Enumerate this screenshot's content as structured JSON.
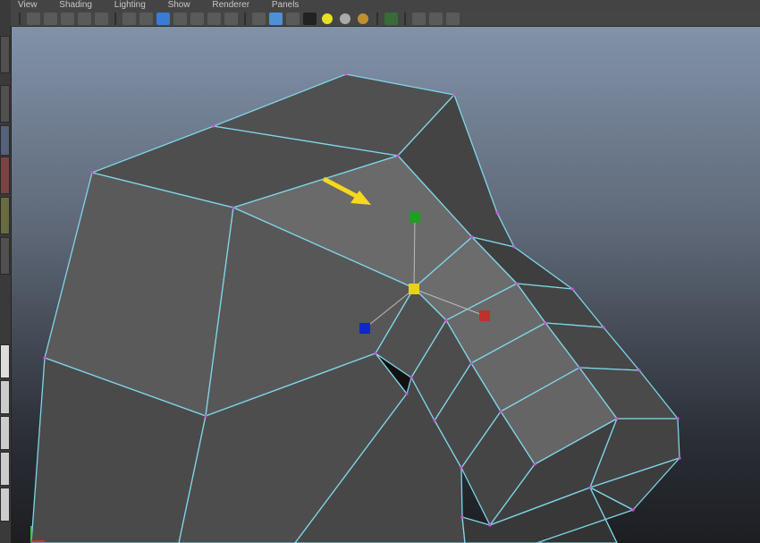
{
  "menu": [
    "View",
    "Shading",
    "Lighting",
    "Show",
    "Renderer",
    "Panels"
  ],
  "toolbar": {
    "groups": [
      [
        "camera-attributes-icon",
        "camera-bookmarks-icon",
        "image-plane-icon",
        "2d-pan-zoom-icon",
        "grease-pencil-icon"
      ],
      [
        "grid-icon",
        "film-gate-icon",
        "resolution-gate-icon",
        "gate-mask-icon",
        "field-chart-icon",
        "safe-action-icon",
        "safe-title-icon"
      ],
      [
        "wireframe-icon",
        "smooth-shade-icon",
        "wireframe-on-shaded-icon",
        "textured-icon",
        "default-lighting-icon",
        "all-lights-icon",
        "shadows-icon"
      ],
      [
        "isolate-select-icon"
      ],
      [
        "xray-icon",
        "xray-joints-icon",
        "share-icon"
      ]
    ]
  },
  "colors": {
    "wire": "#7ed6ea",
    "vertex": "#d24fe0",
    "arrow": "#f7d81c",
    "gizmo_x": "#c0302c",
    "gizmo_y": "#1ea020",
    "gizmo_z": "#1028c8",
    "gizmo_center": "#e6d21a"
  }
}
